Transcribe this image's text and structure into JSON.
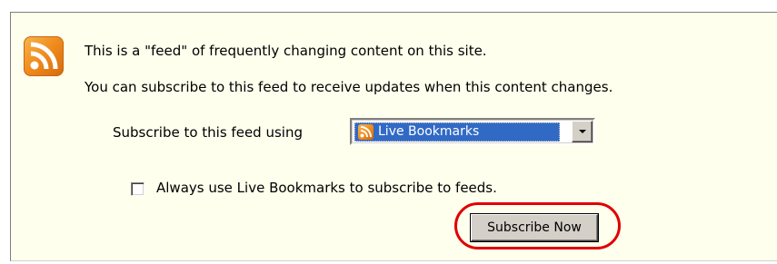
{
  "feed_intro": {
    "line1": "This is a \"feed\" of frequently changing content on this site.",
    "line2": "You can subscribe to this feed to receive updates when this content changes."
  },
  "subscribe": {
    "label": "Subscribe to this feed using",
    "selected_reader": "Live Bookmarks",
    "selected_reader_icon": "rss-icon"
  },
  "always_use": {
    "label": "Always use Live Bookmarks to subscribe to feeds.",
    "checked": false
  },
  "subscribe_button": {
    "label": "Subscribe Now"
  },
  "annotation": {
    "color": "#e00000",
    "shape": "rounded-rectangle highlight around subscribe button"
  },
  "colors": {
    "panel_background": "#ffffee",
    "rss_orange": "#f08a1c",
    "selection_blue": "#316ac5"
  }
}
